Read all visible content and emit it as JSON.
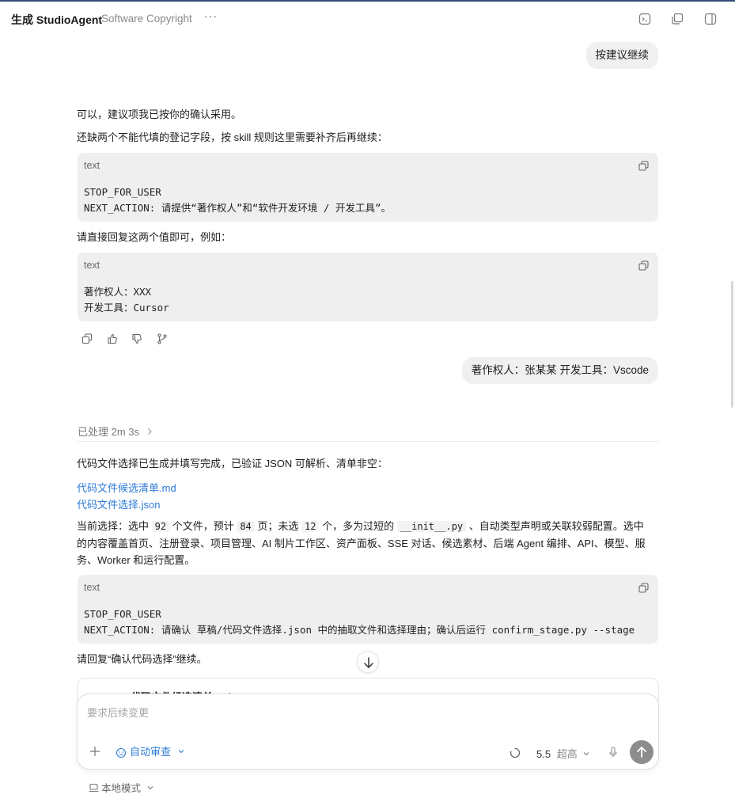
{
  "header": {
    "title": "生成 StudioAgent",
    "subtitle": "Software Copyright",
    "more": "···"
  },
  "messages": {
    "user1": "按建议继续",
    "para1": "可以，建议项我已按你的确认采用。",
    "para2": "还缺两个不能代填的登记字段，按 skill 规则这里需要补齐后再继续：",
    "code1": {
      "lang": "text",
      "line1": "STOP_FOR_USER",
      "line2": "NEXT_ACTION: 请提供“著作权人”和“软件开发环境 / 开发工具”。"
    },
    "para3": "请直接回复这两个值即可，例如：",
    "code2": {
      "lang": "text",
      "line1": "著作权人：XXX",
      "line2": "开发工具：Cursor"
    },
    "user2": "著作权人：张某某 开发工具：Vscode",
    "processed": "已处理 2m 3s",
    "para4": "代码文件选择已生成并填写完成，已验证 JSON 可解析、清单非空：",
    "link1": "代码文件候选清单.md",
    "link2": "代码文件选择.json",
    "para5": {
      "a": "当前选择：选中 ",
      "n1": "92",
      "b": " 个文件，预计 ",
      "n2": "84",
      "c": " 页；未选 ",
      "n3": "12",
      "d": " 个，多为过短的 ",
      "code": "__init__.py",
      "e": " 、自动类型声明或关联较弱配置。选中",
      "line2": "的内容覆盖首页、注册登录、项目管理、AI 制片工作区、资产面板、SSE 对话、候选素材、后端 Agent 编排、API、模型、服",
      "line3": "务、Worker 和运行配置。"
    },
    "code3": {
      "lang": "text",
      "line1": "STOP_FOR_USER",
      "line2": "NEXT_ACTION: 请确认 草稿/代码文件选择.json 中的抽取文件和选择理由；确认后运行 confirm_stage.py --stage"
    },
    "para6": "请回复“确认代码选择”继续。",
    "file_card": "代码文件候选清单.md"
  },
  "composer": {
    "placeholder": "要求后续变更",
    "auto_review": "自动审查",
    "model_version": "5.5",
    "model_mode": "超高"
  },
  "footer": {
    "local_mode": "本地模式"
  }
}
